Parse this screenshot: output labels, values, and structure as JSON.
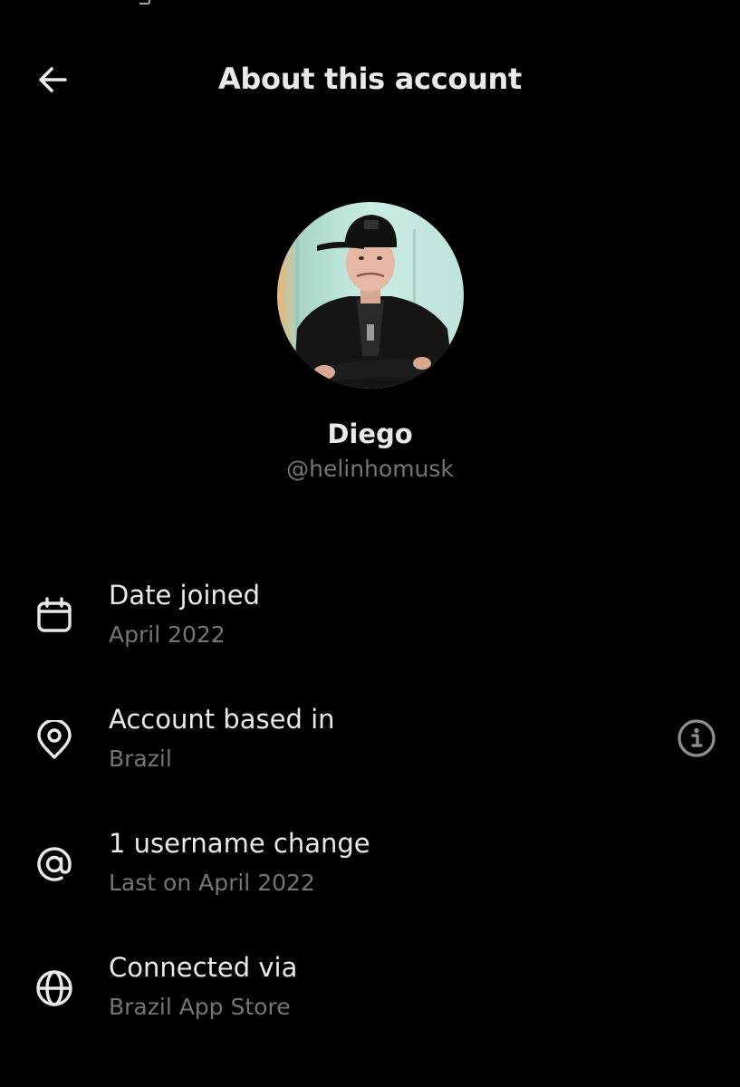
{
  "header": {
    "title": "About this account",
    "back_icon": "arrow-left-icon"
  },
  "profile": {
    "display_name": "Diego",
    "handle": "@helinhomusk"
  },
  "rows": [
    {
      "icon": "calendar-icon",
      "title": "Date joined",
      "subtitle": "April 2022"
    },
    {
      "icon": "location-pin-icon",
      "title": "Account based in",
      "subtitle": "Brazil",
      "trailing_icon": "info-icon"
    },
    {
      "icon": "at-sign-icon",
      "title": "1 username change",
      "subtitle": "Last on April 2022"
    },
    {
      "icon": "globe-icon",
      "title": "Connected via",
      "subtitle": "Brazil App Store"
    }
  ],
  "colors": {
    "background": "#000000",
    "primary_text": "#e7e9ea",
    "secondary_text": "#71767b"
  }
}
